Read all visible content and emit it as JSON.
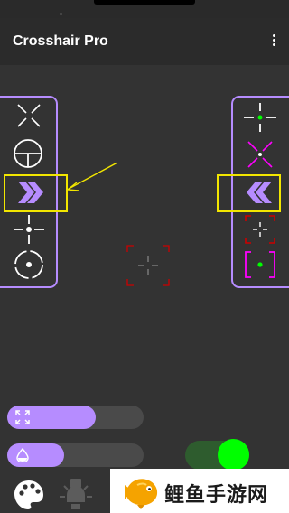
{
  "app": {
    "title": "Crosshair Pro",
    "menu_icon": "more-vert-icon"
  },
  "left_panel": {
    "items": [
      {
        "name": "x-cross-icon"
      },
      {
        "name": "scope-circle-icon"
      },
      {
        "name": "double-chevron-right-icon",
        "selected": true
      },
      {
        "name": "dot-cross-icon"
      },
      {
        "name": "circle-dot-icon"
      }
    ]
  },
  "right_panel": {
    "items": [
      {
        "name": "green-dot-cross-icon"
      },
      {
        "name": "magenta-x-dot-icon"
      },
      {
        "name": "double-chevron-left-icon",
        "selected": true
      },
      {
        "name": "red-bracket-cross-icon"
      },
      {
        "name": "magenta-bracket-green-dot-icon"
      }
    ]
  },
  "sliders": {
    "size": {
      "icon": "expand-icon",
      "value": 0.65
    },
    "opacity": {
      "icon": "drop-icon",
      "value": 0.42
    }
  },
  "toggle": {
    "on": true
  },
  "bottom": {
    "palette": "palette-icon",
    "lamp": "lamp-icon"
  },
  "watermark": {
    "text": "鲤鱼手游网"
  },
  "colors": {
    "accent": "#b68cff",
    "highlight": "#f2e600",
    "green": "#00ff00",
    "magenta": "#ff00ff",
    "red": "#cc0000"
  }
}
